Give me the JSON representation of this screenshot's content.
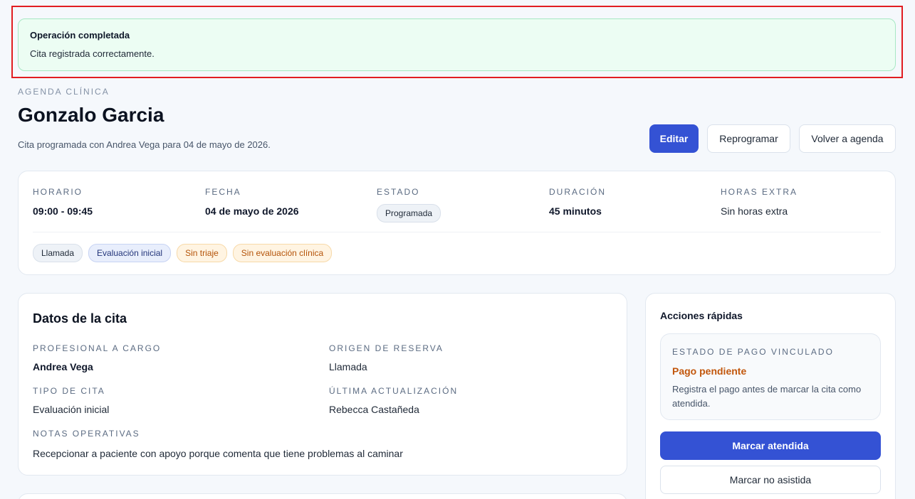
{
  "alert": {
    "title": "Operación completada",
    "message": "Cita registrada correctamente."
  },
  "header": {
    "eyebrow": "AGENDA CLÍNICA",
    "title": "Gonzalo Garcia",
    "subtitle": "Cita programada con Andrea Vega para 04 de mayo de 2026.",
    "buttons": {
      "edit": "Editar",
      "reschedule": "Reprogramar",
      "back": "Volver a agenda"
    }
  },
  "summary": {
    "horario": {
      "label": "HORARIO",
      "value": "09:00 - 09:45"
    },
    "fecha": {
      "label": "FECHA",
      "value": "04 de mayo de 2026"
    },
    "estado": {
      "label": "ESTADO",
      "value": "Programada"
    },
    "duracion": {
      "label": "DURACIÓN",
      "value": "45 minutos"
    },
    "horas_extra": {
      "label": "HORAS EXTRA",
      "value": "Sin horas extra"
    },
    "tags": [
      "Llamada",
      "Evaluación inicial",
      "Sin triaje",
      "Sin evaluación clínica"
    ]
  },
  "details": {
    "title": "Datos de la cita",
    "profesional": {
      "label": "PROFESIONAL A CARGO",
      "value": "Andrea Vega"
    },
    "origen": {
      "label": "ORIGEN DE RESERVA",
      "value": "Llamada"
    },
    "tipo": {
      "label": "TIPO DE CITA",
      "value": "Evaluación inicial"
    },
    "actualizacion": {
      "label": "ÚLTIMA ACTUALIZACIÓN",
      "value": "Rebecca Castañeda"
    },
    "notas": {
      "label": "NOTAS OPERATIVAS",
      "value": "Recepcionar a paciente con apoyo porque comenta que tiene problemas al caminar"
    }
  },
  "quick_actions": {
    "title": "Acciones rápidas",
    "payment": {
      "label": "ESTADO DE PAGO VINCULADO",
      "status": "Pago pendiente",
      "help": "Registra el pago antes de marcar la cita como atendida."
    },
    "mark_attended": "Marcar atendida",
    "mark_no_show": "Marcar no asistida"
  },
  "colors": {
    "primary": "#3452d4",
    "success_bg": "#ecfdf3",
    "warning_text": "#c2570c",
    "focus_frame": "#e11d21"
  }
}
